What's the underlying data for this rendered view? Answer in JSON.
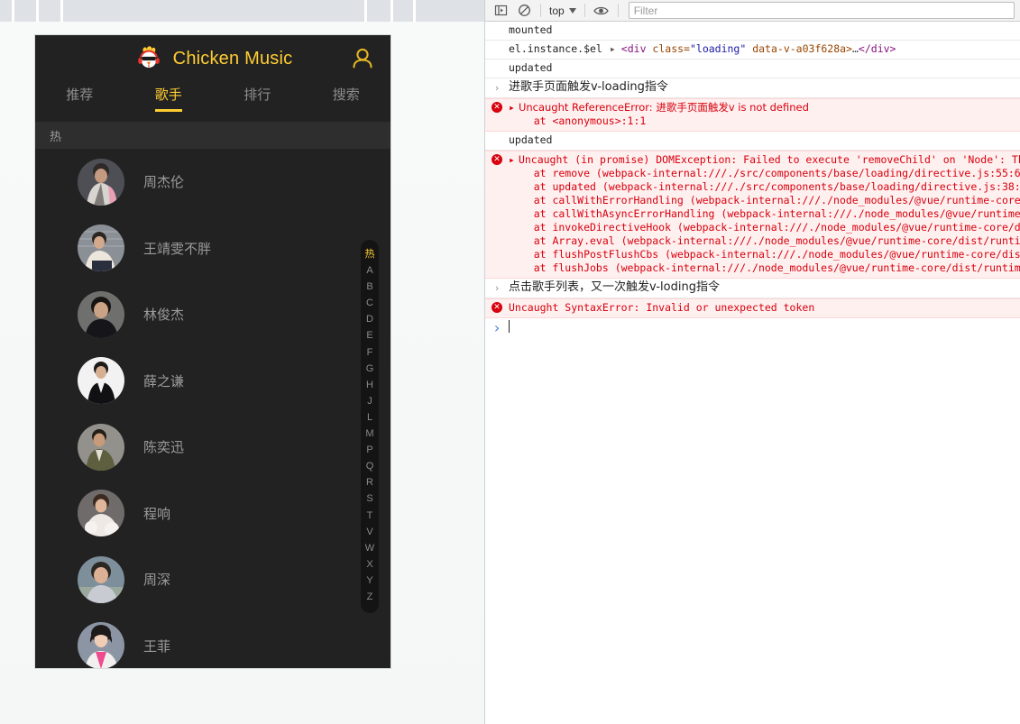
{
  "browser": {
    "toolbar_separator_positions": [
      13,
      40,
      67,
      404,
      433,
      458
    ]
  },
  "app": {
    "title": "Chicken Music",
    "logo_icon": "chicken-logo-icon",
    "user_icon": "user-avatar-icon",
    "accent_color": "#ffcd32",
    "background_color": "#222222",
    "tabs": [
      {
        "label": "推荐",
        "active": false
      },
      {
        "label": "歌手",
        "active": true
      },
      {
        "label": "排行",
        "active": false
      },
      {
        "label": "搜索",
        "active": false
      }
    ],
    "group_header": "热",
    "singers": [
      {
        "name": "周杰伦"
      },
      {
        "name": "王靖雯不胖"
      },
      {
        "name": "林俊杰"
      },
      {
        "name": "薛之谦"
      },
      {
        "name": "陈奕迅"
      },
      {
        "name": "程响"
      },
      {
        "name": "周深"
      },
      {
        "name": "王菲"
      }
    ],
    "index_letters": [
      "热",
      "A",
      "B",
      "C",
      "D",
      "E",
      "F",
      "G",
      "H",
      "J",
      "L",
      "M",
      "P",
      "Q",
      "R",
      "S",
      "T",
      "V",
      "W",
      "X",
      "Y",
      "Z"
    ]
  },
  "devtools": {
    "toolbar": {
      "sidebar_toggle_icon": "console-sidebar-icon",
      "clear_icon": "clear-console-icon",
      "context_label": "top",
      "context_caret_icon": "chevron-down-icon",
      "eye_icon": "live-expression-eye-icon",
      "filter_placeholder": "Filter",
      "filter_value": ""
    },
    "entries": [
      {
        "type": "log",
        "text": "mounted"
      },
      {
        "type": "log-object",
        "label": "el.instance.$el",
        "expander": "▸",
        "html_tag_open": "<div",
        "html_attr1_name": " class=",
        "html_attr1_value": "\"loading\"",
        "html_attr2": " data-v-a03f628a>",
        "html_ellipsis": "…",
        "html_tag_close": "</div>"
      },
      {
        "type": "log",
        "text": "updated"
      },
      {
        "type": "input",
        "prompt": "›",
        "text": "进歌手页面触发v-loading指令"
      },
      {
        "type": "error",
        "badge_icon": "error-circle-icon",
        "expander": "▸",
        "lines": [
          "Uncaught ReferenceError: 进歌手页面触发v is not defined",
          "    at <anonymous>:1:1"
        ]
      },
      {
        "type": "log",
        "text": "updated"
      },
      {
        "type": "error",
        "badge_icon": "error-circle-icon",
        "expander": "▸",
        "lines": [
          "Uncaught (in promise) DOMException: Failed to execute 'removeChild' on 'Node': Th",
          "    at remove (webpack-internal:///./src/components/base/loading/directive.js:55:6",
          "    at updated (webpack-internal:///./src/components/base/loading/directive.js:38:",
          "    at callWithErrorHandling (webpack-internal:///./node_modules/@vue/runtime-core",
          "    at callWithAsyncErrorHandling (webpack-internal:///./node_modules/@vue/runtime",
          "    at invokeDirectiveHook (webpack-internal:///./node_modules/@vue/runtime-core/d",
          "    at Array.eval (webpack-internal:///./node_modules/@vue/runtime-core/dist/runti",
          "    at flushPostFlushCbs (webpack-internal:///./node_modules/@vue/runtime-core/dis",
          "    at flushJobs (webpack-internal:///./node_modules/@vue/runtime-core/dist/runtim"
        ],
        "link_lines": [
          false,
          true,
          true,
          true,
          true,
          true,
          true,
          true,
          true
        ]
      },
      {
        "type": "input",
        "prompt": "›",
        "text": "点击歌手列表，又一次触发v-loding指令"
      },
      {
        "type": "error-single",
        "badge_icon": "error-circle-icon",
        "text": "Uncaught SyntaxError: Invalid or unexpected token"
      },
      {
        "type": "prompt",
        "prompt": "›",
        "value": ""
      }
    ]
  }
}
